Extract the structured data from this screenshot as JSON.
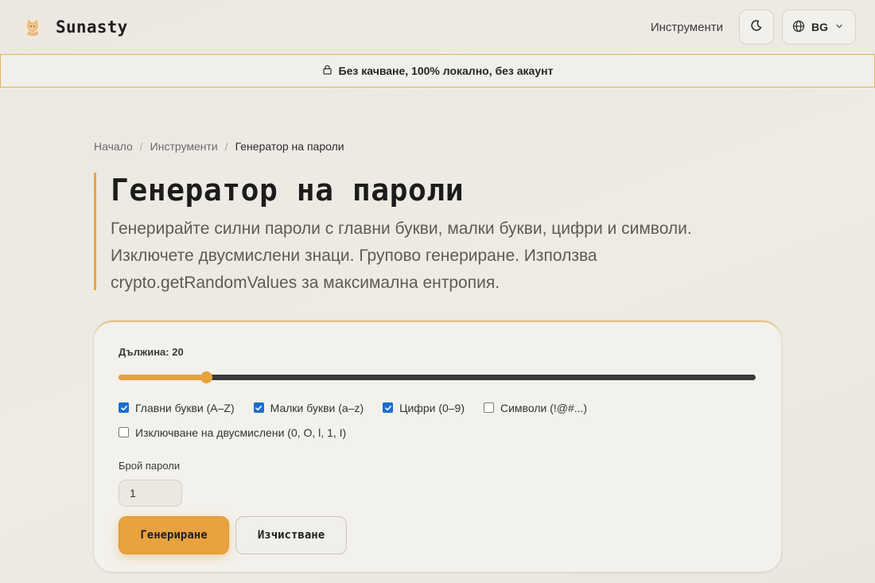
{
  "header": {
    "brand": "Sunasty",
    "logo_icon": "cat-logo-icon",
    "nav_tools": "Инструменти",
    "theme_icon": "moon-icon",
    "language": "BG",
    "language_icon": "globe-icon",
    "language_chevron_icon": "chevron-down-icon"
  },
  "banner": {
    "icon": "lock-icon",
    "text": "Без качване, 100% локално, без акаунт"
  },
  "breadcrumb": {
    "home": "Начало",
    "tools": "Инструменти",
    "current": "Генератор на пароли",
    "separator": "/"
  },
  "hero": {
    "title": "Генератор на пароли",
    "description": "Генерирайте силни пароли с главни букви, малки букви, цифри и символи. Изключете двусмислени знаци. Групово генериране. Използва crypto.getRandomValues за максимална ентропия."
  },
  "form": {
    "length_label": "Дължина: 20",
    "length_value": 20,
    "length_slider_fraction": 0.137,
    "options": [
      {
        "label": "Главни букви (A–Z)",
        "checked": true
      },
      {
        "label": "Малки букви (a–z)",
        "checked": true
      },
      {
        "label": "Цифри (0–9)",
        "checked": true
      },
      {
        "label": "Символи (!@#...)",
        "checked": false
      },
      {
        "label": "Изключване на двусмислени (0, O, l, 1, I)",
        "checked": false
      }
    ],
    "count_label": "Брой пароли",
    "count_value": "1",
    "generate_label": "Генериране",
    "clear_label": "Изчистване"
  },
  "colors": {
    "accent": "#e8a23e",
    "checkbox": "#1a6fd0",
    "banner_border": "#e5b15d"
  }
}
